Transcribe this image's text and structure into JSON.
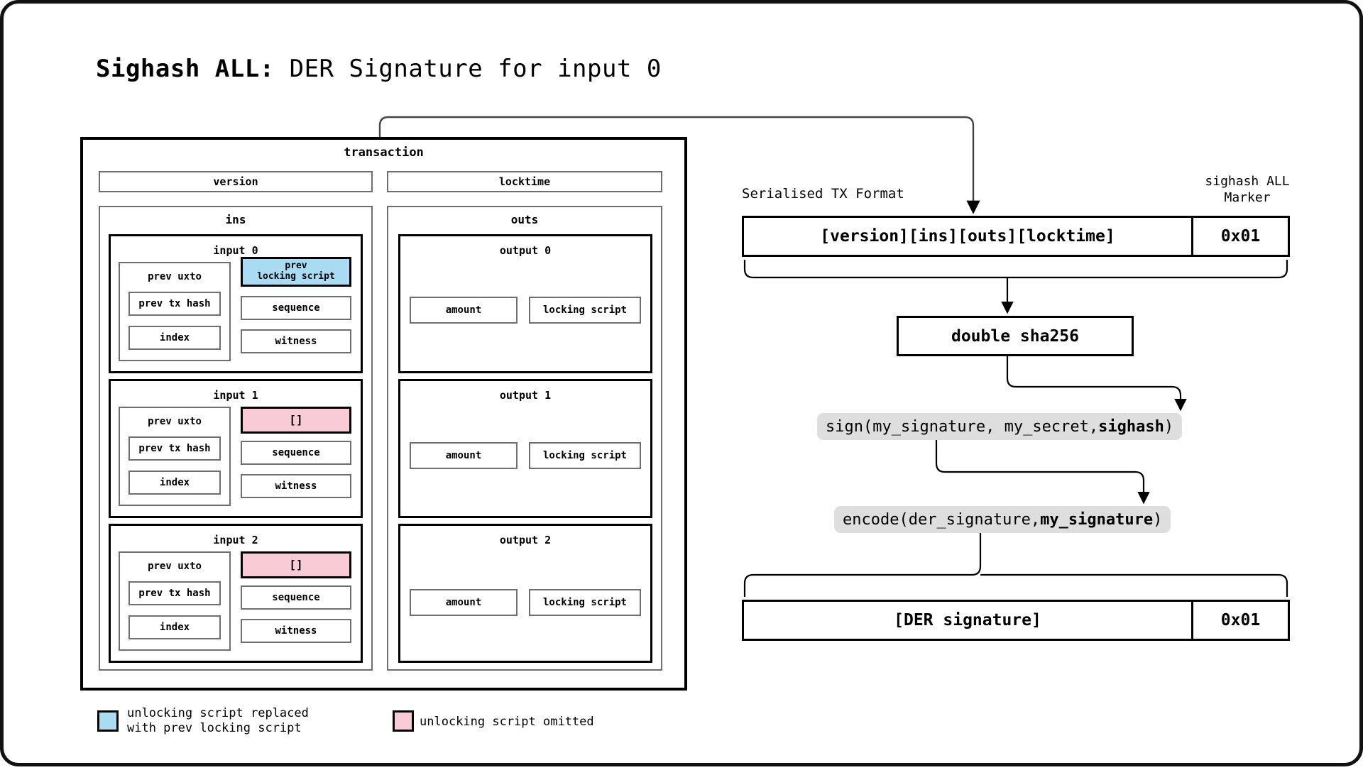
{
  "title": {
    "bold": "Sighash ALL:",
    "rest": " DER Signature for input 0"
  },
  "transaction": {
    "label": "transaction",
    "version_label": "version",
    "locktime_label": "locktime",
    "ins_label": "ins",
    "outs_label": "outs",
    "inputs": [
      {
        "label": "input 0",
        "utxo_label": "prev uxto",
        "prev_tx_hash": "prev tx hash",
        "index": "index",
        "script": "prev\nlocking script",
        "script_state": "replaced",
        "sequence": "sequence",
        "witness": "witness"
      },
      {
        "label": "input 1",
        "utxo_label": "prev uxto",
        "prev_tx_hash": "prev tx hash",
        "index": "index",
        "script": "[]",
        "script_state": "omitted",
        "sequence": "sequence",
        "witness": "witness"
      },
      {
        "label": "input 2",
        "utxo_label": "prev uxto",
        "prev_tx_hash": "prev tx hash",
        "index": "index",
        "script": "[]",
        "script_state": "omitted",
        "sequence": "sequence",
        "witness": "witness"
      }
    ],
    "outputs": [
      {
        "label": "output 0",
        "amount": "amount",
        "locking_script": "locking script"
      },
      {
        "label": "output 1",
        "amount": "amount",
        "locking_script": "locking script"
      },
      {
        "label": "output 2",
        "amount": "amount",
        "locking_script": "locking script"
      }
    ]
  },
  "legend": [
    {
      "color": "#a9dcf2",
      "text": "unlocking script replaced\nwith prev locking script"
    },
    {
      "color": "#f9cbd6",
      "text": "unlocking script omitted"
    }
  ],
  "flow": {
    "serialised_label": "Serialised TX Format",
    "marker_label": "sighash ALL\nMarker",
    "serialised_value": "[version][ins][outs][locktime]",
    "serialised_marker": "0x01",
    "hash_step": "double sha256",
    "sign_step": {
      "prefix": "sign(my_signature, my_secret, ",
      "emphasis": "sighash",
      "suffix": ")"
    },
    "encode_step": {
      "prefix": "encode(der_signature, ",
      "emphasis": "my_signature",
      "suffix": ")"
    },
    "result_value": "[DER signature]",
    "result_marker": "0x01"
  },
  "colors": {
    "blue": "#a9dcf2",
    "pink": "#f9cbd6",
    "pill": "#dedede",
    "border": "#000000"
  }
}
